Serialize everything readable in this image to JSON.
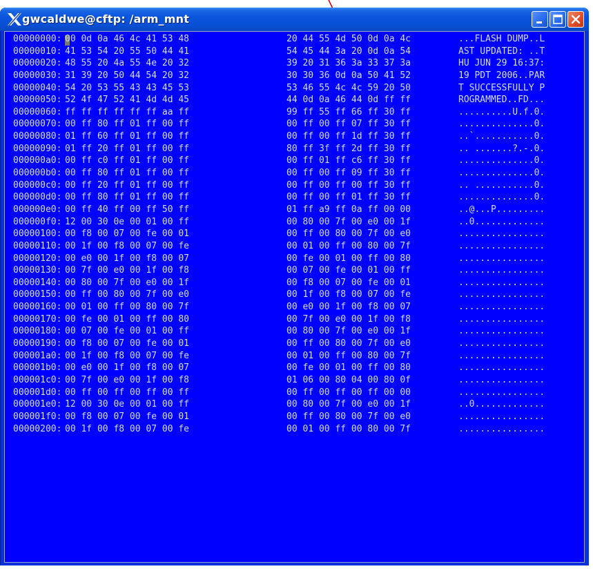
{
  "window": {
    "title": "gwcaldwe@cftp: /arm_mnt"
  },
  "icons": {
    "app": "x-logo-icon",
    "minimize": "minimize-icon",
    "maximize": "maximize-icon",
    "close": "close-icon",
    "annotation": "red-arrow-icon"
  },
  "colors": {
    "terminal_bg": "#0000ff",
    "terminal_text": "#d6dcff",
    "arrow": "#e00000"
  },
  "dump": [
    {
      "addr": "00000000:",
      "h1": "00 0d 0a 46 4c 41 53 48",
      "h2": "20 44 55 4d 50 0d 0a 4c",
      "ascii": "...FLASH DUMP..L"
    },
    {
      "addr": "00000010:",
      "h1": "41 53 54 20 55 50 44 41",
      "h2": "54 45 44 3a 20 0d 0a 54",
      "ascii": "AST UPDATED: ..T"
    },
    {
      "addr": "00000020:",
      "h1": "48 55 20 4a 55 4e 20 32",
      "h2": "39 20 31 36 3a 33 37 3a",
      "ascii": "HU JUN 29 16:37:"
    },
    {
      "addr": "00000030:",
      "h1": "31 39 20 50 44 54 20 32",
      "h2": "30 30 36 0d 0a 50 41 52",
      "ascii": "19 PDT 2006..PAR"
    },
    {
      "addr": "00000040:",
      "h1": "54 20 53 55 43 43 45 53",
      "h2": "53 46 55 4c 4c 59 20 50",
      "ascii": "T SUCCESSFULLY P"
    },
    {
      "addr": "00000050:",
      "h1": "52 4f 47 52 41 4d 4d 45",
      "h2": "44 0d 0a 46 44 0d ff ff",
      "ascii": "ROGRAMMED..FD..."
    },
    {
      "addr": "00000060:",
      "h1": "ff ff ff ff ff ff aa ff",
      "h2": "99 ff 55 ff 66 ff 30 ff",
      "ascii": "..........U.f.0."
    },
    {
      "addr": "00000070:",
      "h1": "00 ff 80 ff 01 ff 00 ff",
      "h2": "00 ff 00 ff 07 ff 30 ff",
      "ascii": "..............0."
    },
    {
      "addr": "00000080:",
      "h1": "01 ff 60 ff 01 ff 00 ff",
      "h2": "00 ff 00 ff 1d ff 30 ff",
      "ascii": "..`...........0."
    },
    {
      "addr": "00000090:",
      "h1": "01 ff 20 ff 01 ff 00 ff",
      "h2": "80 ff 3f ff 2d ff 30 ff",
      "ascii": ".. .......?.-.0."
    },
    {
      "addr": "000000a0:",
      "h1": "00 ff c0 ff 01 ff 00 ff",
      "h2": "00 ff 01 ff c6 ff 30 ff",
      "ascii": "..............0."
    },
    {
      "addr": "000000b0:",
      "h1": "00 ff 80 ff 01 ff 00 ff",
      "h2": "00 ff 00 ff 09 ff 30 ff",
      "ascii": "..............0."
    },
    {
      "addr": "000000c0:",
      "h1": "00 ff 20 ff 01 ff 00 ff",
      "h2": "00 ff 00 ff 00 ff 30 ff",
      "ascii": ".. ...........0."
    },
    {
      "addr": "000000d0:",
      "h1": "00 ff 80 ff 01 ff 00 ff",
      "h2": "00 ff 00 ff 01 ff 30 ff",
      "ascii": "..............0."
    },
    {
      "addr": "000000e0:",
      "h1": "00 ff 40 ff 00 ff 50 ff",
      "h2": "01 ff a9 ff 0a ff 00 00",
      "ascii": "..@...P........."
    },
    {
      "addr": "000000f0:",
      "h1": "12 00 30 0e 00 01 00 ff",
      "h2": "00 80 00 7f 00 e0 00 1f",
      "ascii": "..0............."
    },
    {
      "addr": "00000100:",
      "h1": "00 f8 00 07 00 fe 00 01",
      "h2": "00 ff 00 80 00 7f 00 e0",
      "ascii": "................"
    },
    {
      "addr": "00000110:",
      "h1": "00 1f 00 f8 00 07 00 fe",
      "h2": "00 01 00 ff 00 80 00 7f",
      "ascii": "................"
    },
    {
      "addr": "00000120:",
      "h1": "00 e0 00 1f 00 f8 00 07",
      "h2": "00 fe 00 01 00 ff 00 80",
      "ascii": "................"
    },
    {
      "addr": "00000130:",
      "h1": "00 7f 00 e0 00 1f 00 f8",
      "h2": "00 07 00 fe 00 01 00 ff",
      "ascii": "................"
    },
    {
      "addr": "00000140:",
      "h1": "00 80 00 7f 00 e0 00 1f",
      "h2": "00 f8 00 07 00 fe 00 01",
      "ascii": "................"
    },
    {
      "addr": "00000150:",
      "h1": "00 ff 00 80 00 7f 00 e0",
      "h2": "00 1f 00 f8 00 07 00 fe",
      "ascii": "................"
    },
    {
      "addr": "00000160:",
      "h1": "00 01 00 ff 00 80 00 7f",
      "h2": "00 e0 00 1f 00 f8 00 07",
      "ascii": "................"
    },
    {
      "addr": "00000170:",
      "h1": "00 fe 00 01 00 ff 00 80",
      "h2": "00 7f 00 e0 00 1f 00 f8",
      "ascii": "................"
    },
    {
      "addr": "00000180:",
      "h1": "00 07 00 fe 00 01 00 ff",
      "h2": "00 80 00 7f 00 e0 00 1f",
      "ascii": "................"
    },
    {
      "addr": "00000190:",
      "h1": "00 f8 00 07 00 fe 00 01",
      "h2": "00 ff 00 80 00 7f 00 e0",
      "ascii": "................"
    },
    {
      "addr": "000001a0:",
      "h1": "00 1f 00 f8 00 07 00 fe",
      "h2": "00 01 00 ff 00 80 00 7f",
      "ascii": "................"
    },
    {
      "addr": "000001b0:",
      "h1": "00 e0 00 1f 00 f8 00 07",
      "h2": "00 fe 00 01 00 ff 00 80",
      "ascii": "................"
    },
    {
      "addr": "000001c0:",
      "h1": "00 7f 00 e0 00 1f 00 f8",
      "h2": "01 06 00 80 04 00 80 0f",
      "ascii": "................"
    },
    {
      "addr": "000001d0:",
      "h1": "00 ff 00 ff 00 ff 00 ff",
      "h2": "00 ff 00 ff 00 ff 00 00",
      "ascii": "................"
    },
    {
      "addr": "000001e0:",
      "h1": "12 00 30 0e 00 01 00 ff",
      "h2": "00 80 00 7f 00 e0 00 1f",
      "ascii": "..0............."
    },
    {
      "addr": "000001f0:",
      "h1": "00 f8 00 07 00 fe 00 01",
      "h2": "00 ff 00 80 00 7f 00 e0",
      "ascii": "................"
    },
    {
      "addr": "00000200:",
      "h1": "00 1f 00 f8 00 07 00 fe",
      "h2": "00 01 00 ff 00 80 00 7f",
      "ascii": "................"
    }
  ]
}
